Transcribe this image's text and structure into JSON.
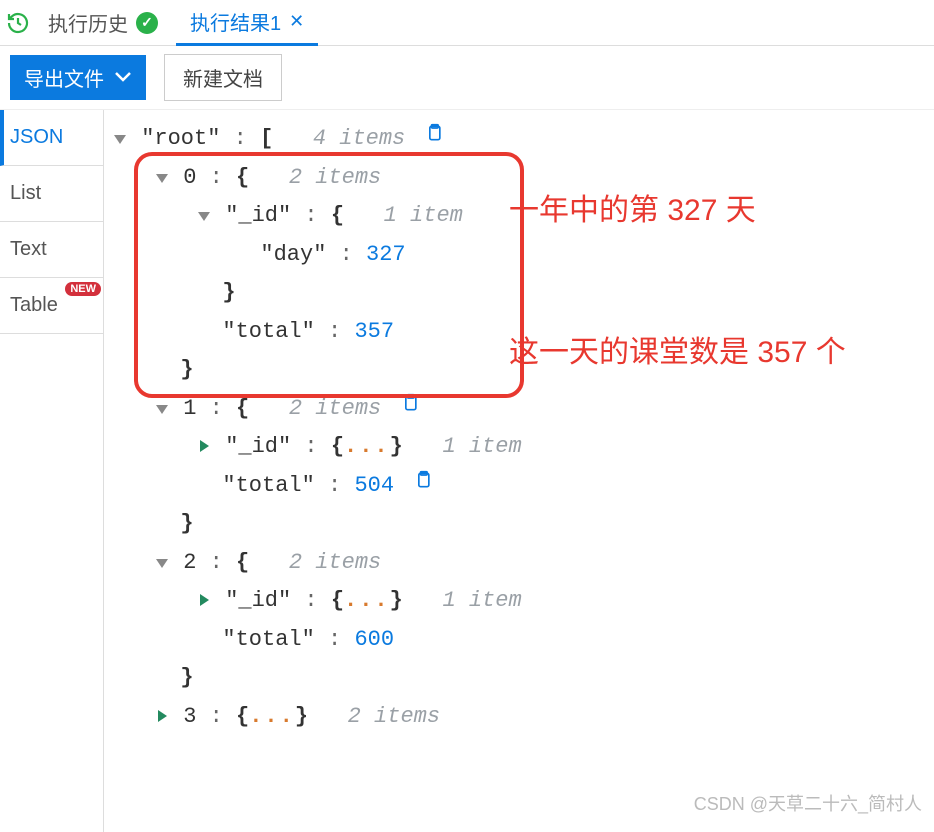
{
  "tabs": {
    "history": "执行历史",
    "result": "执行结果1"
  },
  "toolbar": {
    "export_label": "导出文件",
    "new_doc_label": "新建文档"
  },
  "view_tabs": {
    "json": "JSON",
    "list": "List",
    "text": "Text",
    "table": "Table",
    "table_badge": "NEW"
  },
  "tree": {
    "root_key": "\"root\"",
    "root_meta": "4 items",
    "items": [
      {
        "idx": "0",
        "meta": "2 items",
        "id_key": "\"_id\"",
        "id_meta": "1 item",
        "day_key": "\"day\"",
        "day_val": "327",
        "total_key": "\"total\"",
        "total_val": "357"
      },
      {
        "idx": "1",
        "meta": "2 items",
        "id_key": "\"_id\"",
        "id_meta": "1 item",
        "total_key": "\"total\"",
        "total_val": "504"
      },
      {
        "idx": "2",
        "meta": "2 items",
        "id_key": "\"_id\"",
        "id_meta": "1 item",
        "total_key": "\"total\"",
        "total_val": "600"
      },
      {
        "idx": "3",
        "meta": "2 items"
      }
    ]
  },
  "brackets": {
    "open_sq": "[",
    "open_br": "{",
    "close_br": "}",
    "ellipsis": "...",
    "colon": " : "
  },
  "annotations": {
    "line1": "一年中的第 327 天",
    "line2": "这一天的课堂数是 357 个"
  },
  "watermark": "CSDN @天草二十六_简村人"
}
